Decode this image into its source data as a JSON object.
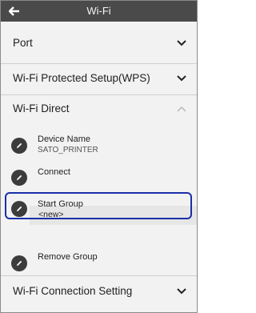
{
  "header": {
    "title": "Wi-Fi"
  },
  "sections": {
    "port": {
      "label": "Port"
    },
    "wps": {
      "label": "Wi-Fi Protected Setup(WPS)"
    },
    "direct": {
      "label": "Wi-Fi Direct"
    },
    "connection": {
      "label": "Wi-Fi Connection Setting"
    }
  },
  "direct_items": {
    "device_name": {
      "label": "Device Name",
      "value": "SATO_PRINTER"
    },
    "connect": {
      "label": "Connect"
    },
    "start_group": {
      "label": "Start Group",
      "value": "<new>"
    },
    "remove_group": {
      "label": "Remove Group"
    }
  },
  "colors": {
    "header_bg": "#4a4a4a",
    "highlight": "#1a2fa8",
    "page_bg": "#f2f2f2"
  }
}
